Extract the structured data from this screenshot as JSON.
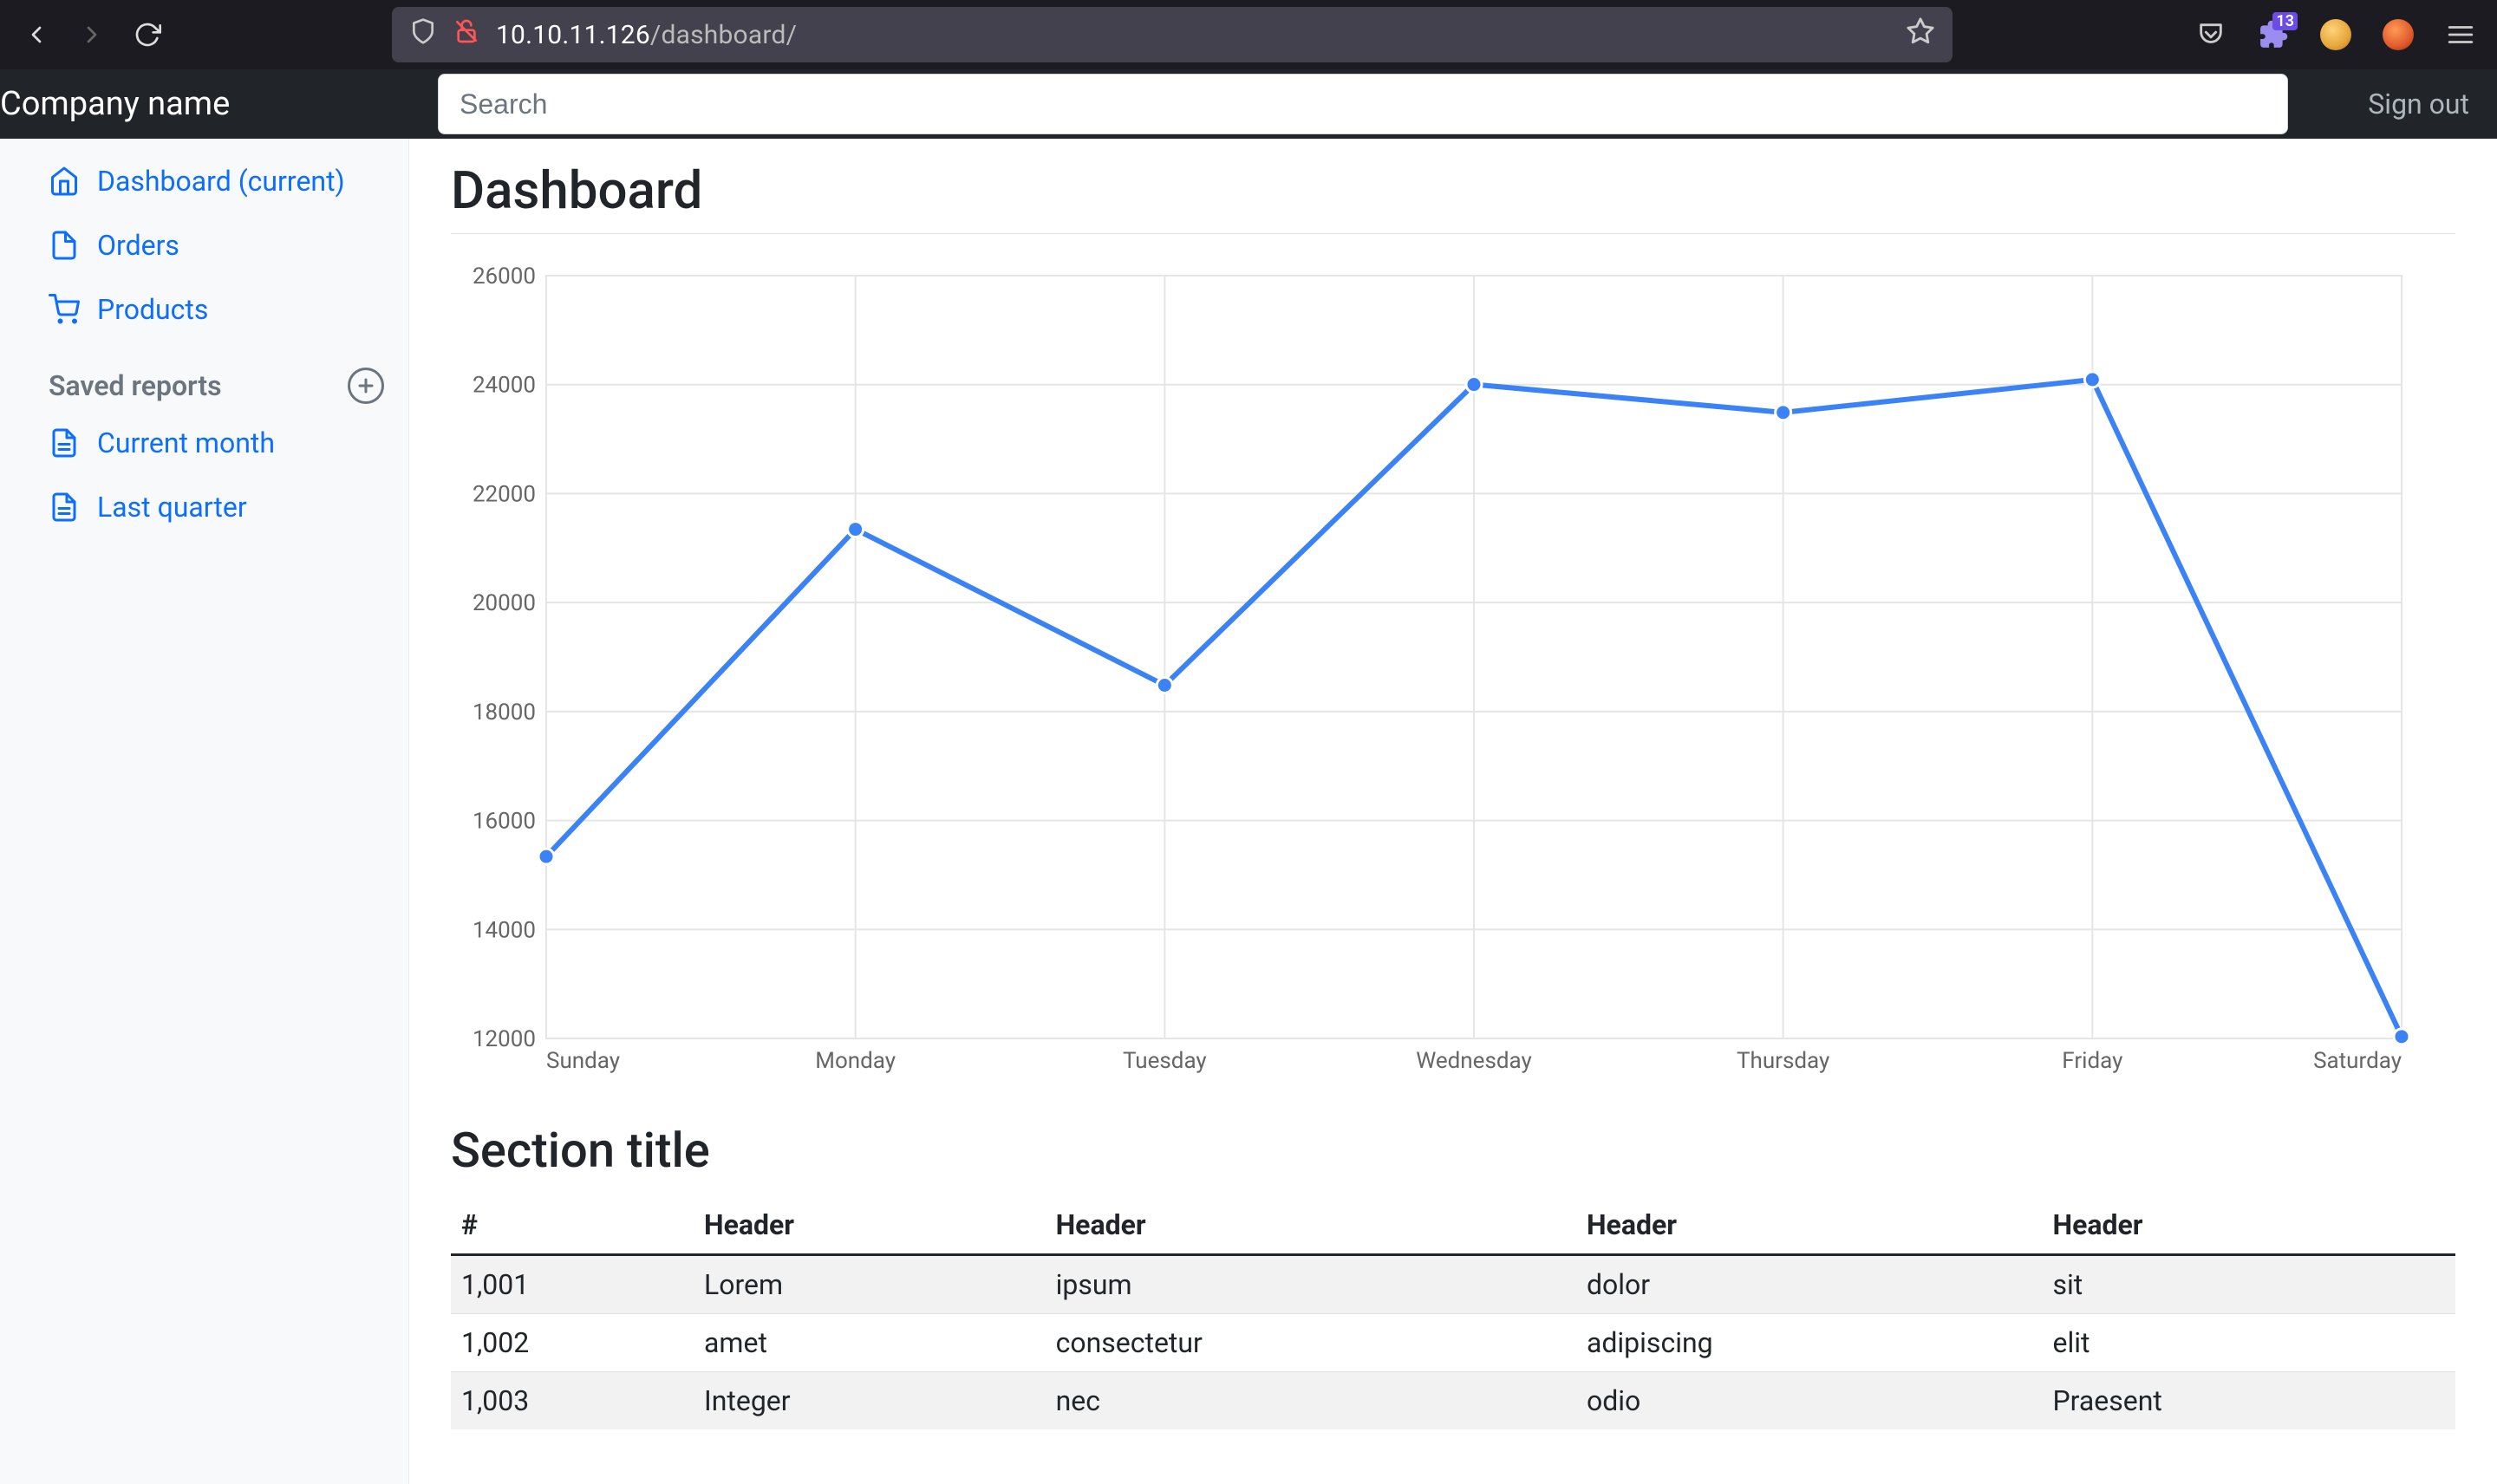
{
  "browser": {
    "url_host": "10.10.11.126",
    "url_path": "/dashboard/",
    "badge": "13"
  },
  "navbar": {
    "brand": "Company name",
    "search_placeholder": "Search",
    "signout": "Sign out"
  },
  "sidebar": {
    "items": [
      {
        "label": "Dashboard (current)",
        "icon": "home-icon"
      },
      {
        "label": "Orders",
        "icon": "file-icon"
      },
      {
        "label": "Products",
        "icon": "cart-icon"
      }
    ],
    "reports_heading": "Saved reports",
    "reports": [
      {
        "label": "Current month",
        "icon": "file-text-icon"
      },
      {
        "label": "Last quarter",
        "icon": "file-text-icon"
      }
    ]
  },
  "main": {
    "title": "Dashboard",
    "section_title": "Section title"
  },
  "chart_data": {
    "type": "line",
    "categories": [
      "Sunday",
      "Monday",
      "Tuesday",
      "Wednesday",
      "Thursday",
      "Friday",
      "Saturday"
    ],
    "values": [
      15339,
      21345,
      18483,
      24003,
      23489,
      24092,
      12034
    ],
    "ylim": [
      12000,
      26000
    ],
    "yticks": [
      12000,
      14000,
      16000,
      18000,
      20000,
      22000,
      24000,
      26000
    ],
    "title": "",
    "xlabel": "",
    "ylabel": ""
  },
  "table": {
    "headers": [
      "#",
      "Header",
      "Header",
      "Header",
      "Header"
    ],
    "rows": [
      [
        "1,001",
        "Lorem",
        "ipsum",
        "dolor",
        "sit"
      ],
      [
        "1,002",
        "amet",
        "consectetur",
        "adipiscing",
        "elit"
      ],
      [
        "1,003",
        "Integer",
        "nec",
        "odio",
        "Praesent"
      ]
    ]
  }
}
